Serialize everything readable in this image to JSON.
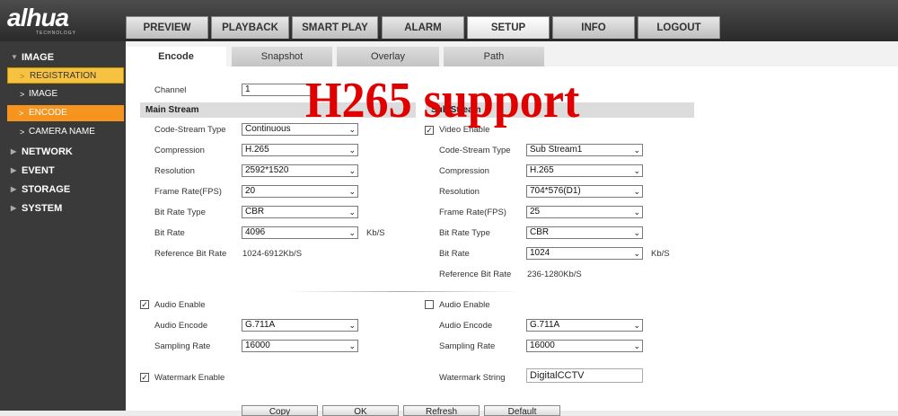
{
  "logo": {
    "brand": "alhua",
    "tagline": "TECHNOLOGY"
  },
  "nav": [
    "PREVIEW",
    "PLAYBACK",
    "SMART PLAY",
    "ALARM",
    "SETUP",
    "INFO",
    "LOGOUT"
  ],
  "sidebar": {
    "image": "IMAGE",
    "registration": "REGISTRATION",
    "image_sub": "IMAGE",
    "encode": "ENCODE",
    "camera_name": "CAMERA NAME",
    "network": "NETWORK",
    "event": "EVENT",
    "storage": "STORAGE",
    "system": "SYSTEM"
  },
  "tabs": [
    "Encode",
    "Snapshot",
    "Overlay",
    "Path"
  ],
  "channel": {
    "label": "Channel",
    "value": "1"
  },
  "main_stream": {
    "title": "Main Stream",
    "code_stream_type": {
      "label": "Code-Stream Type",
      "value": "Continuous"
    },
    "compression": {
      "label": "Compression",
      "value": "H.265"
    },
    "resolution": {
      "label": "Resolution",
      "value": "2592*1520"
    },
    "frame_rate": {
      "label": "Frame Rate(FPS)",
      "value": "20"
    },
    "bit_rate_type": {
      "label": "Bit Rate Type",
      "value": "CBR"
    },
    "bit_rate": {
      "label": "Bit Rate",
      "value": "4096",
      "unit": "Kb/S"
    },
    "reference": {
      "label": "Reference Bit Rate",
      "value": "1024-6912Kb/S"
    }
  },
  "sub_stream": {
    "title": "Sub Stream",
    "video_enable": {
      "label": "Video Enable",
      "checked": true
    },
    "code_stream_type": {
      "label": "Code-Stream Type",
      "value": "Sub Stream1"
    },
    "compression": {
      "label": "Compression",
      "value": "H.265"
    },
    "resolution": {
      "label": "Resolution",
      "value": "704*576(D1)"
    },
    "frame_rate": {
      "label": "Frame Rate(FPS)",
      "value": "25"
    },
    "bit_rate_type": {
      "label": "Bit Rate Type",
      "value": "CBR"
    },
    "bit_rate": {
      "label": "Bit Rate",
      "value": "1024",
      "unit": "Kb/S"
    },
    "reference": {
      "label": "Reference Bit Rate",
      "value": "236-1280Kb/S"
    }
  },
  "audio_main": {
    "enable": {
      "label": "Audio Enable",
      "checked": true
    },
    "encode": {
      "label": "Audio Encode",
      "value": "G.711A"
    },
    "sampling": {
      "label": "Sampling Rate",
      "value": "16000"
    }
  },
  "audio_sub": {
    "enable": {
      "label": "Audio Enable",
      "checked": false
    },
    "encode": {
      "label": "Audio Encode",
      "value": "G.711A"
    },
    "sampling": {
      "label": "Sampling Rate",
      "value": "16000"
    }
  },
  "watermark": {
    "enable_label": "Watermark Enable",
    "checked": true,
    "string_label": "Watermark String",
    "string_value": "DigitalCCTV"
  },
  "buttons": [
    "Copy",
    "OK",
    "Refresh",
    "Default"
  ],
  "overlay_text": "H265 support",
  "colors": {
    "accent_yellow": "#f5c242",
    "accent_orange": "#f5951f",
    "overlay_red": "#e00000"
  }
}
